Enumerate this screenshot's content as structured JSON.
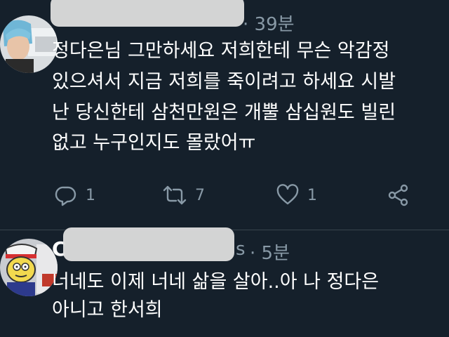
{
  "tweet1": {
    "time": "· 39분",
    "lines": [
      "정다은님 그만하세요 저희한테 무슨 악감정",
      "있으셔서 지금 저희를 죽이려고 하세요 시발",
      "난 당신한테 삼천만원은 개뿔 삼십원도 빌린",
      "없고 누구인지도 몰랐어ㅠ"
    ],
    "actions": {
      "reply_icon": "reply-icon",
      "reply_count": "1",
      "retweet_icon": "retweet-icon",
      "retweet_count": "7",
      "like_icon": "heart-icon",
      "like_count": "1",
      "share_icon": "share-icon"
    }
  },
  "tweet2": {
    "name_initial": "C",
    "handle_suffix": "s",
    "time": "· 5분",
    "lines": [
      "너네도 이제 너네 삶을 살아..아 나 정다은",
      "아니고 한서희"
    ]
  },
  "colors": {
    "background": "#15202b",
    "secondary_text": "#8899a6",
    "divider": "#38444d"
  }
}
